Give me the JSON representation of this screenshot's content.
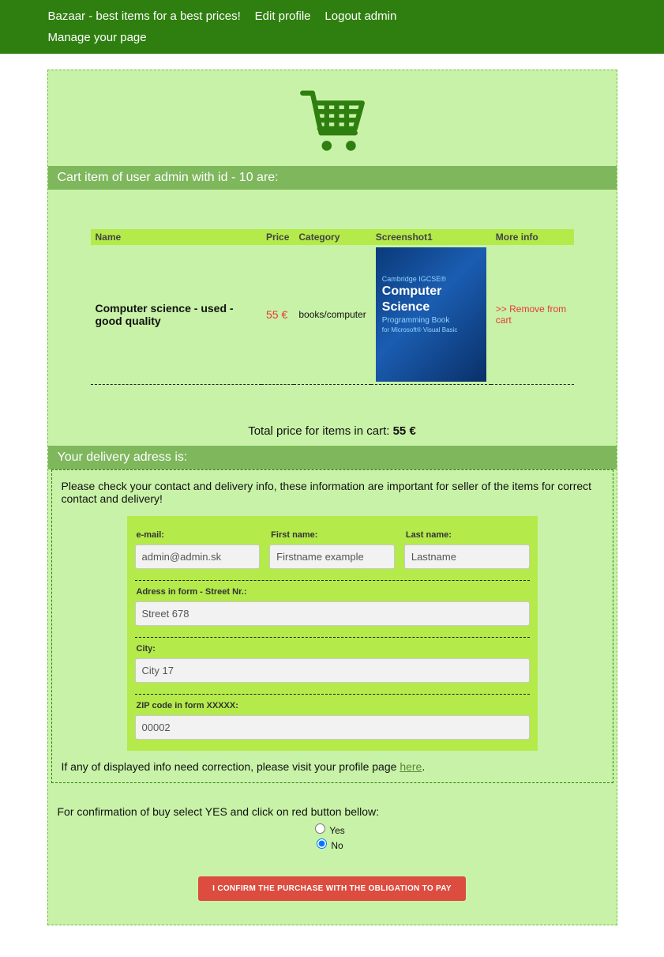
{
  "nav": {
    "home": "Bazaar - best items for a best prices!",
    "edit_profile": "Edit profile",
    "logout": "Logout admin",
    "manage_page": "Manage your page"
  },
  "cart_header": "Cart item of user admin with id - 10 are:",
  "table": {
    "headers": {
      "name": "Name",
      "price": "Price",
      "category": "Category",
      "screenshot": "Screenshot1",
      "more": "More info"
    },
    "row": {
      "name": "Computer science - used - good quality",
      "price": "55 €",
      "category": "books/computer",
      "remove": ">> Remove from cart"
    }
  },
  "book_cover": {
    "line1": "Cambridge IGCSE®",
    "line2a": "Computer",
    "line2b": "Science",
    "line3": "Programming Book",
    "line4": "for Microsoft® Visual Basic"
  },
  "total": {
    "prefix": "Total price for items in cart: ",
    "value": "55 €"
  },
  "delivery_header": "Your delivery adress is:",
  "delivery_instr": "Please check your contact and delivery info, these information are important for seller of the items for correct contact and delivery!",
  "form": {
    "email_label": "e-mail:",
    "email_value": "admin@admin.sk",
    "first_label": "First name:",
    "first_value": "Firstname example",
    "last_label": "Last name:",
    "last_value": "Lastname",
    "address_label": "Adress in form - Street Nr.:",
    "address_value": "Street 678",
    "city_label": "City:",
    "city_value": "City 17",
    "zip_label": "ZIP code in form XXXXX:",
    "zip_value": "00002"
  },
  "correction_text": "If any of displayed info need correction, please visit your profile page ",
  "correction_link": "here",
  "confirm_prompt": "For confirmation of buy select YES and click on red button bellow:",
  "radio": {
    "yes": "Yes",
    "no": "No"
  },
  "buy_button": "I CONFIRM THE PURCHASE WITH THE OBLIGATION TO PAY"
}
